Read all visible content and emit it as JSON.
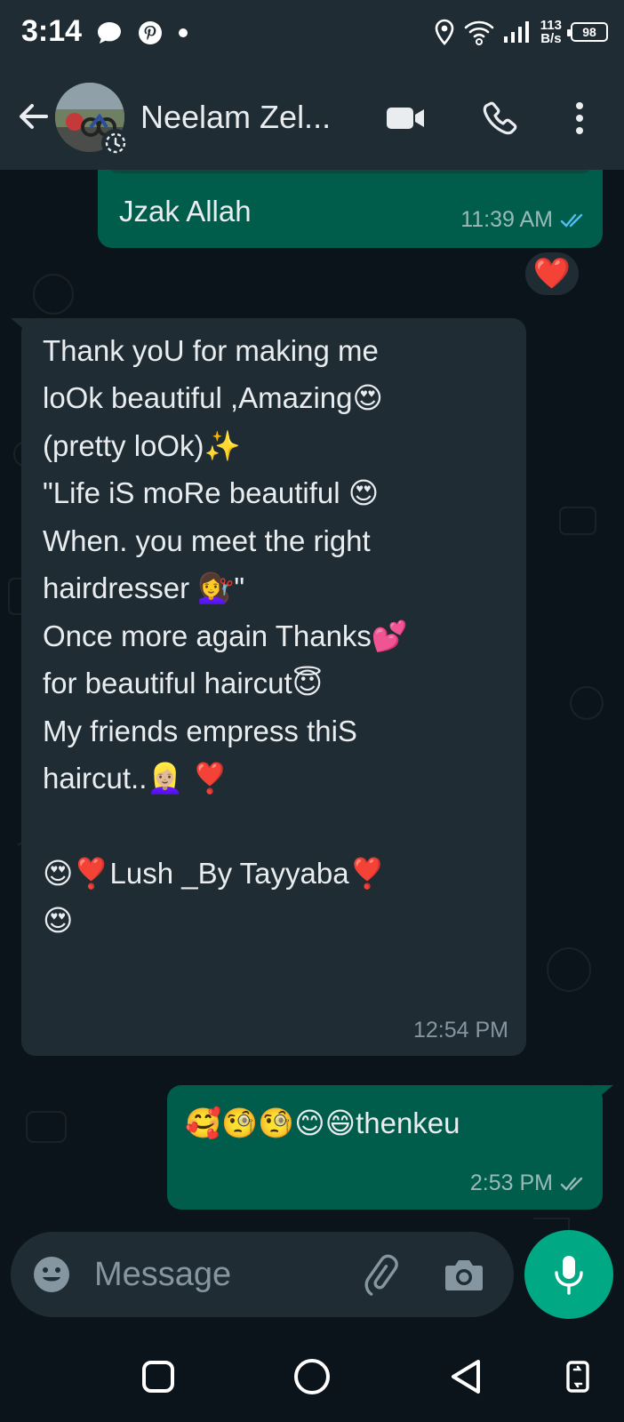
{
  "status_bar": {
    "time": "3:14",
    "net_speed_value": "113",
    "net_speed_unit": "B/s",
    "battery": "98",
    "icons": [
      "chat-bubble-icon",
      "pinterest-icon",
      "dot-icon",
      "location-icon",
      "wifi-icon",
      "signal-icon",
      "battery-icon"
    ]
  },
  "header": {
    "contact_name": "Neelam Zel...",
    "icons": [
      "back-arrow-icon",
      "video-call-icon",
      "voice-call-icon",
      "more-options-icon"
    ]
  },
  "messages": [
    {
      "direction": "outgoing",
      "text": "Jzak Allah",
      "time": "11:39 AM",
      "status": "read",
      "reaction": "❤️"
    },
    {
      "direction": "incoming",
      "lines": [
        "Thank yoU for making me",
        "loOk beautiful ,Amazing😍",
        "(pretty loOk)✨",
        "\"Life iS moRe beautiful 😍",
        "When.  you meet the right",
        "hairdresser 💇‍♀️\"",
        "Once more again Thanks💕",
        "for beautiful haircut😇",
        "My friends empress thiS",
        "haircut..👱🏼‍♀️ ❣️",
        "",
        "😍❣️Lush _By Tayyaba❣️",
        "😍"
      ],
      "time": "12:54 PM"
    },
    {
      "direction": "outgoing",
      "text": "🥰🧐🧐😊😄thenkeu",
      "time": "2:53 PM",
      "status": "read"
    }
  ],
  "input": {
    "placeholder": "Message",
    "icons": [
      "emoji-icon",
      "attach-icon",
      "camera-icon",
      "mic-icon"
    ]
  },
  "nav": {
    "icons": [
      "recents-icon",
      "home-icon",
      "back-icon",
      "rotate-icon"
    ]
  },
  "colors": {
    "header_bg": "#1f2c34",
    "chat_bg": "#0b141a",
    "outgoing_bubble": "#005c4b",
    "incoming_bubble": "#1f2c34",
    "accent": "#00a884",
    "read_ticks": "#53bdeb"
  }
}
